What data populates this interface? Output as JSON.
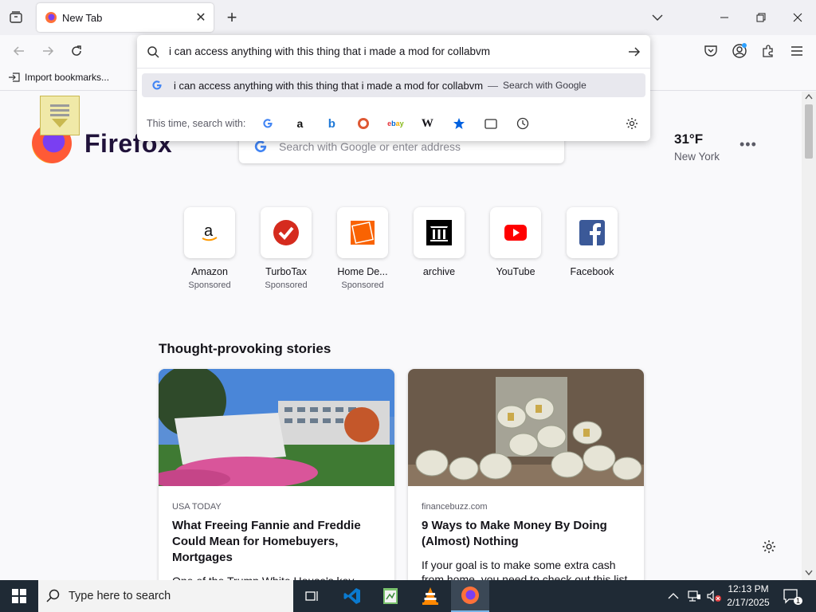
{
  "browser": {
    "tab": {
      "title": "New Tab"
    },
    "bookmarks_bar": {
      "import_label": "Import bookmarks..."
    }
  },
  "urlbar": {
    "value": "i can access anything with this thing that i made a mod for collabvm",
    "suggestion": {
      "text": "i can access anything with this thing that i made a mod for collabvm",
      "separator": "—",
      "action": "Search with Google"
    },
    "engines_label": "This time, search with:",
    "engines": [
      "google",
      "amazon",
      "bing",
      "duckduckgo",
      "ebay",
      "wikipedia",
      "bookmarks",
      "tabs",
      "history"
    ]
  },
  "newtab": {
    "brand": "Firefox",
    "search_placeholder": "Search with Google or enter address",
    "weather": {
      "temp": "31°F",
      "city": "New York"
    },
    "shortcuts": [
      {
        "name": "Amazon",
        "sub": "Sponsored"
      },
      {
        "name": "TurboTax",
        "sub": "Sponsored"
      },
      {
        "name": "Home De...",
        "sub": "Sponsored"
      },
      {
        "name": "archive",
        "sub": ""
      },
      {
        "name": "YouTube",
        "sub": ""
      },
      {
        "name": "Facebook",
        "sub": ""
      }
    ],
    "stories_title": "Thought-provoking stories",
    "stories": [
      {
        "source": "USA TODAY",
        "headline": "What Freeing Fannie and Freddie Could Mean for Homebuyers, Mortgages",
        "desc": "One of the Trump White House's key"
      },
      {
        "source": "financebuzz.com",
        "headline": "9 Ways to Make Money By Doing (Almost) Nothing",
        "desc": "If your goal is to make some extra cash from home, you need to check out this list"
      }
    ]
  },
  "taskbar": {
    "search_placeholder": "Type here to search",
    "time": "12:13 PM",
    "date": "2/17/2025",
    "notification_count": "1"
  },
  "colors": {
    "accent": "#0061e0",
    "taskbar": "#1f2a35",
    "tab_strip": "#f0f0f4"
  }
}
